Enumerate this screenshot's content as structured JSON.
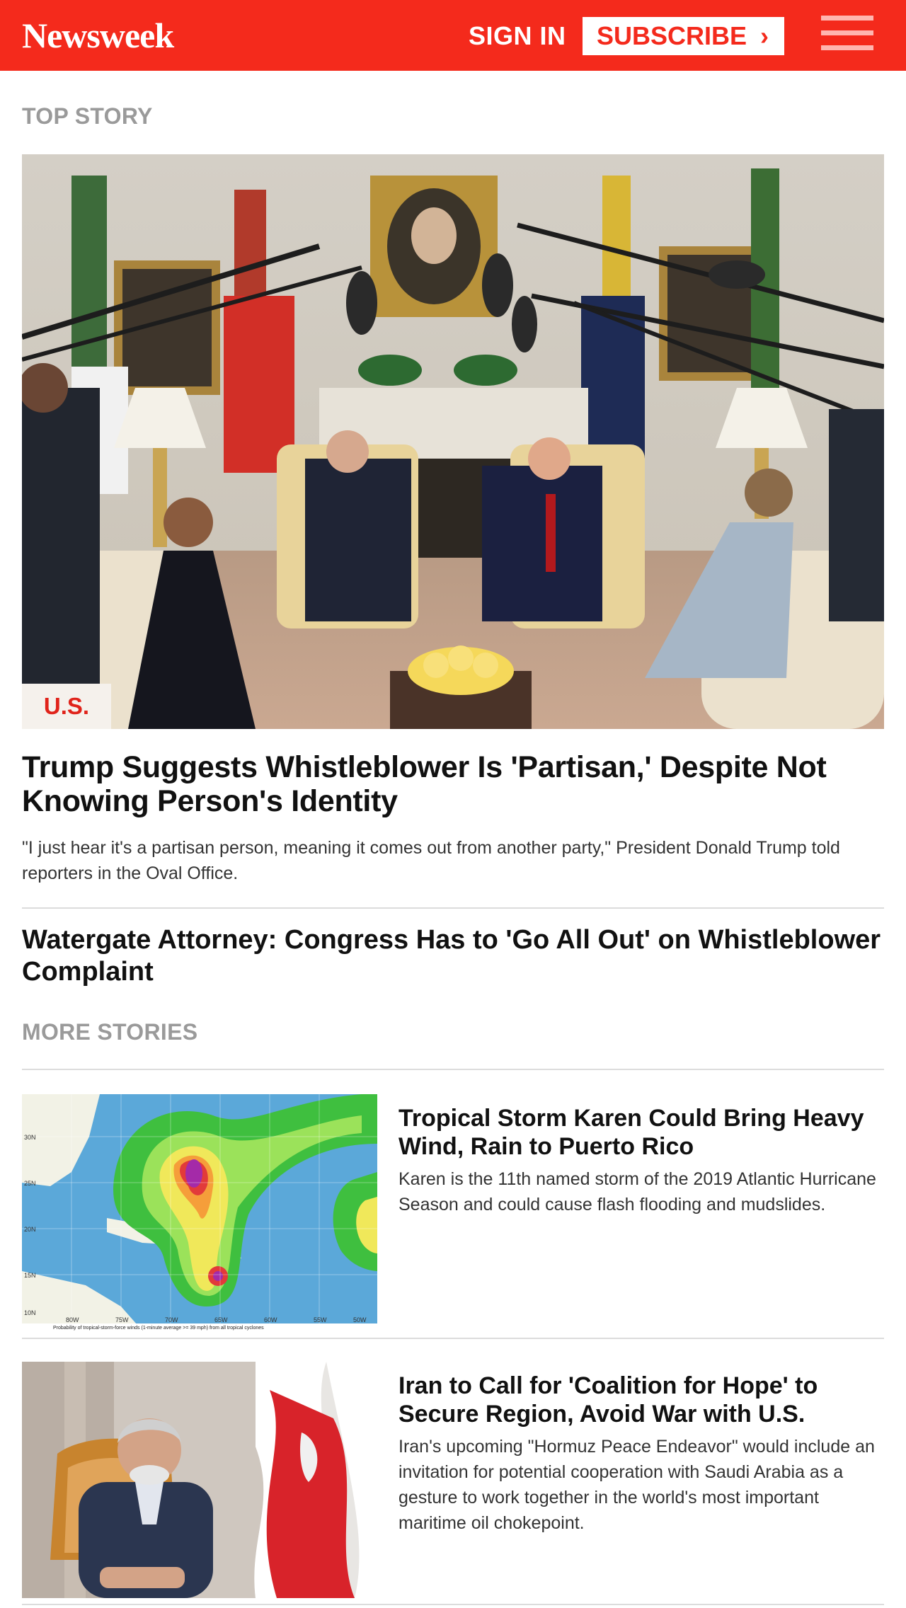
{
  "header": {
    "logo": "Newsweek",
    "sign_in": "SIGN IN",
    "subscribe": "SUBSCRIBE",
    "subscribe_icon": "chevron-right-icon",
    "menu_icon": "hamburger-menu-icon",
    "brand_color": "#f42a1c"
  },
  "top_story": {
    "section_label": "TOP STORY",
    "category": "U.S.",
    "headline": "Trump Suggests Whistleblower Is 'Partisan,' Despite Not Knowing Person's Identity",
    "summary": "\"I just hear it's a partisan person, meaning it comes out from another party,\" President Donald Trump told reporters in the Oval Office.",
    "secondary_headline": "Watergate Attorney: Congress Has to 'Go All Out' on Whistleblower Complaint"
  },
  "more_stories": {
    "section_label": "MORE STORIES",
    "items": [
      {
        "title": "Tropical Storm Karen Could Bring Heavy Wind, Rain to Puerto Rico",
        "summary": "Karen is the 11th named storm of the 2019 Atlantic Hurricane Season and could cause flash flooding and mudslides.",
        "map": {
          "lat_labels": [
            "30N",
            "25N",
            "20N",
            "15N",
            "10N"
          ],
          "lon_labels": [
            "80W",
            "75W",
            "70W",
            "65W",
            "60W",
            "55W",
            "50W"
          ],
          "caption": "Probability of tropical-storm-force winds (1-minute average >= 39 mph) from all tropical cyclones"
        }
      },
      {
        "title": "Iran to Call for 'Coalition for Hope' to Secure Region, Avoid War with U.S.",
        "summary": "Iran's upcoming \"Hormuz Peace Endeavor\" would include an invitation for potential cooperation with Saudi Arabia as a gesture to work together in the world's most important maritime oil chokepoint."
      }
    ]
  }
}
